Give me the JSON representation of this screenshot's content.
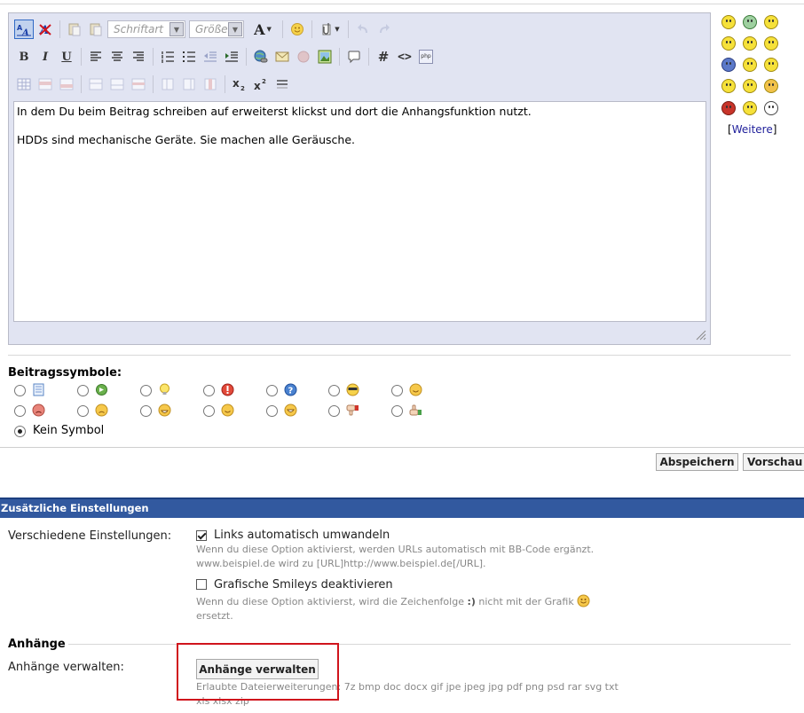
{
  "toolbar": {
    "font_placeholder": "Schriftart",
    "size_placeholder": "Größe",
    "bold_label": "B",
    "italic_label": "I",
    "underline_label": "U",
    "hash_label": "#",
    "code_label": "<>",
    "php_label": "php",
    "font_color_label": "A"
  },
  "editor": {
    "lines": [
      "In dem Du beim Beitrag schreiben auf erweiterst klickst und dort die Anhangsfunktion nutzt.",
      "HDDs sind mechanische Geräte. Sie machen alle Geräusche."
    ]
  },
  "smilies": {
    "more_open": "[",
    "more_link": "Weitere",
    "more_close": "]"
  },
  "post_icons": {
    "title": "Beitragssymbole:",
    "no_icon_label": "Kein Symbol",
    "selected": "none"
  },
  "actions": {
    "save_label": "Abspeichern",
    "preview_label": "Vorschau"
  },
  "additional": {
    "header": "Zusätzliche Einstellungen",
    "misc_label": "Verschiedene Einstellungen:",
    "parse_urls_label": "Links automatisch umwandeln",
    "parse_urls_checked": true,
    "parse_urls_hint_1": "Wenn du diese Option aktivierst, werden URLs automatisch mit BB-Code ergänzt.",
    "parse_urls_hint_2": "www.beispiel.de wird zu [URL]http://www.beispiel.de[/URL].",
    "disable_smilies_label": "Grafische Smileys deaktivieren",
    "disable_smilies_checked": false,
    "disable_smilies_hint_1": "Wenn du diese Option aktivierst, wird die Zeichenfolge",
    "disable_smilies_hint_code": ":)",
    "disable_smilies_hint_2": "nicht mit der Grafik",
    "disable_smilies_hint_3": "ersetzt."
  },
  "attachments": {
    "title": "Anhänge",
    "manage_label": "Anhänge verwalten:",
    "manage_button": "Anhänge verwalten",
    "allowed_line_1": "Erlaubte Dateierweiterungen: 7z bmp doc docx gif jpe jpeg jpg pdf png psd rar svg txt",
    "allowed_line_2": "xls xlsx zip"
  },
  "colors": {
    "section_header": "#32599f",
    "highlight_box": "#d0141c",
    "editor_bg": "#e1e4f2"
  }
}
